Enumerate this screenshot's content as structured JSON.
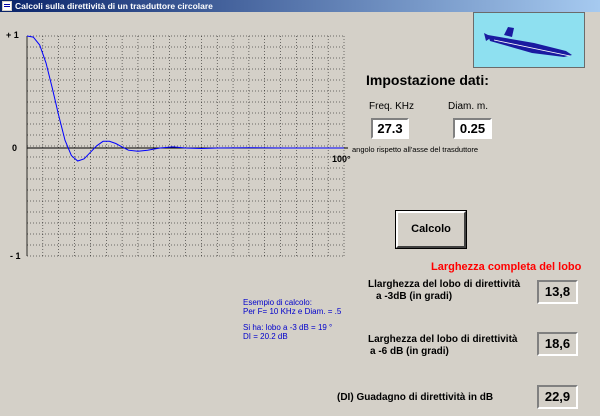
{
  "window": {
    "title": "Calcoli sulla direttività di un trasduttore circolare"
  },
  "chart_data": {
    "type": "line",
    "x_range": [
      0,
      100
    ],
    "y_range": [
      -1,
      1
    ],
    "tick_labels": {
      "y_top": "+ 1",
      "y_mid": "0",
      "y_bottom": "- 1",
      "x_end": "100°"
    },
    "x_axis_label": "angolo rispetto all'asse del trasduttore",
    "grid": true,
    "line_color": "#0000ff",
    "points": [
      [
        0,
        1.0
      ],
      [
        2,
        0.99
      ],
      [
        4,
        0.92
      ],
      [
        6,
        0.76
      ],
      [
        8,
        0.53
      ],
      [
        10,
        0.29
      ],
      [
        12,
        0.07
      ],
      [
        14,
        -0.07
      ],
      [
        16,
        -0.12
      ],
      [
        18,
        -0.1
      ],
      [
        20,
        -0.04
      ],
      [
        22,
        0.02
      ],
      [
        24,
        0.06
      ],
      [
        26,
        0.06
      ],
      [
        28,
        0.04
      ],
      [
        30,
        0.01
      ],
      [
        32,
        -0.02
      ],
      [
        35,
        -0.03
      ],
      [
        38,
        -0.02
      ],
      [
        42,
        0.0
      ],
      [
        46,
        0.01
      ],
      [
        50,
        0.0
      ],
      [
        55,
        -0.005
      ],
      [
        60,
        0.0
      ],
      [
        70,
        0.003
      ],
      [
        80,
        0.0
      ],
      [
        90,
        0.0
      ],
      [
        100,
        0.0
      ]
    ]
  },
  "inputs": {
    "heading": "Impostazione dati:",
    "freq_label": "Freq. KHz",
    "freq_value": "27.3",
    "diam_label": "Diam. m.",
    "diam_value": "0.25"
  },
  "calc_button": "Calcolo",
  "results": {
    "heading": "Larghezza completa del lobo",
    "r1_label": "Llarghezza del lobo di direttività",
    "r1_label2": "a -3dB (in gradi)",
    "r1_value": "13,8",
    "r2_label": "Larghezza del lobo di direttività",
    "r2_label2": "a -6 dB (in gradi)",
    "r2_value": "18,6",
    "r3_label": "(DI) Guadagno di direttività  in dB",
    "r3_value": "22,9"
  },
  "example": {
    "line1": "Esempio di calcolo:",
    "line2": "Per F= 10 KHz e Diam. = .5",
    "line3": "Si ha: lobo a -3 dB = 19 °",
    "line4": "DI = 20.2 dB"
  },
  "colors": {
    "titlebar": "#0a246a",
    "background": "#d4d0c8",
    "logo_bg": "#8ee0f0",
    "example_text": "#0000cc",
    "red_heading": "#ff0000"
  }
}
